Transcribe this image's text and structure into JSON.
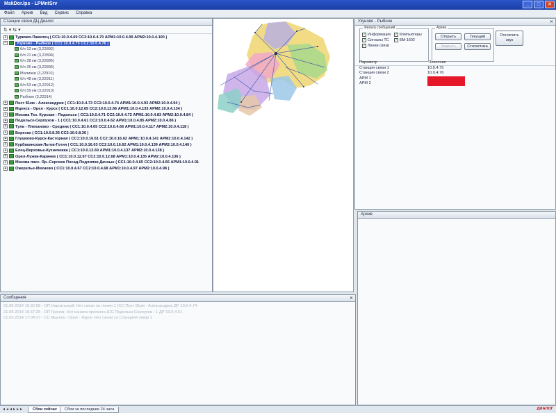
{
  "window": {
    "title": "MskDor.lps - LPMntSrv",
    "controls": [
      "_",
      "□",
      "✕"
    ]
  },
  "menu": [
    "Файл",
    "Архив",
    "Вид",
    "Сервис",
    "Справка"
  ],
  "tree_panel": {
    "title": "Станции связи ДЦ Диалог",
    "toolbar": "⇅ ▾  ⇆ ▾",
    "nodes": [
      {
        "label": "Турково-Павелец ( СС1:10.0.4.69 СС2:10.0.4.70 АРМ1:10.0.4.99 АРМ2:10.0.4.100 )",
        "level": 0,
        "exp": "+"
      },
      {
        "label": "Узуново - Рыбное ( СС1:10.0.4.75 СС2:10.0.4.76 )",
        "level": 0,
        "exp": "−",
        "selected": true
      },
      {
        "label": "б/п 12 км (3,22892)",
        "level": 1
      },
      {
        "label": "б/п 21 км (3,22894)",
        "level": 1
      },
      {
        "label": "б/п 28 км (3,22895)",
        "level": 1
      },
      {
        "label": "б/п 36 км (3,22896)",
        "level": 1
      },
      {
        "label": "Малинки (3,22910)",
        "level": 1
      },
      {
        "label": "б/п 48 км (3,22911)",
        "level": 1
      },
      {
        "label": "б/п 53 км (3,22912)",
        "level": 1
      },
      {
        "label": "б/п 59 км (3,22913)",
        "level": 1
      },
      {
        "label": "Рыбное (3,22914)",
        "level": 1
      },
      {
        "label": "Пост 81км - Александров ( СС1:10.0.4.73 СС2:10.0.4.74 АРМ1:10.0.4.93 АРМ2:10.0.4.94 )",
        "level": 0,
        "exp": "+"
      },
      {
        "label": "Мценск - Орел - Курск ( СС1:10.0.12.65 СС2:10.0.12.66 АРМ1:10.0.4.133 АРМ2:10.0.4.134 )",
        "level": 0,
        "exp": "+"
      },
      {
        "label": "Москва Тех. Курская - Подольск ( СС1:10.0.4.71 СС2:10.0.4.72 АРМ1:10.0.4.83 АРМ2:10.0.4.84 )",
        "level": 0,
        "exp": "+"
      },
      {
        "label": "Подольск-Серпухов - 1 ( СС1:10.0.4.61 СС2:10.0.4.62 АРМ1:10.0.4.85 АРМ2:10.0.4.86 )",
        "level": 0,
        "exp": "+"
      },
      {
        "label": "Тула - Плеханово - Средник ( СС1:10.0.4.65 СС2:10.0.4.66 АРМ1:10.0.4.117 АРМ2:10.0.4.118 )",
        "level": 0,
        "exp": "+"
      },
      {
        "label": "Березки ( СС1:10.0.8.35 СС2:10.0.8.36 )",
        "level": 0,
        "exp": "+"
      },
      {
        "label": "Глушково-Курск-Касторная ( СС1:10.0.16.61 СС2:10.0.16.62 АРМ1:10.0.4.141 АРМ2:10.0.4.142 )",
        "level": 0,
        "exp": "+"
      },
      {
        "label": "Курбакинская-Льгов-Готня ( СС1:10.0.16.63 СС2:10.0.16.62 АРМ1:10.0.4.139 АРМ2:10.0.4.140 )",
        "level": 0,
        "exp": "+"
      },
      {
        "label": "Елец-Верховье-Кузнечевка ( СС1:10.0.12.69 АРМ1:10.0.4.137 АРМ2:10.0.4.138 )",
        "level": 0,
        "exp": "+"
      },
      {
        "label": "Орел-Лужки-Карачев ( СС1:10.0.12.67 СС2:10.0.12.68 АРМ1:10.0.4.135 АРМ2:10.0.4.136 )",
        "level": 0,
        "exp": "+"
      },
      {
        "label": "Москва пасс. Яр.-Сергиев Посад-Подлипки Дачные ( СС1:10.0.4.65 СС2:10.0.4.66 АРМ1:10.0.4.91",
        "level": 0,
        "exp": "+"
      },
      {
        "label": "Ожерелье-Михнево ( СС1:10.0.4.67 СС2:10.0.4.68 АРМ1:10.0.4.97 АРМ2:10.0.4.98 )",
        "level": 0,
        "exp": "+"
      }
    ]
  },
  "station_panel": {
    "title": "Узуново - Рыбное",
    "filter_title": "Фильтр сообщений",
    "filters": [
      {
        "label": "Информация",
        "checked": true
      },
      {
        "label": "Компьютеры",
        "checked": true
      },
      {
        "label": "Сигналы ТС",
        "checked": true
      },
      {
        "label": "БМ-1602",
        "checked": true
      },
      {
        "label": "Линии связи",
        "checked": true
      }
    ],
    "archive_title": "Архив",
    "buttons": {
      "open": "Открыть",
      "current": "Текущий",
      "close": "Закрыть",
      "stats": "Статистика",
      "mute": "Отключить звук"
    },
    "table": {
      "headers": [
        "Параметр",
        "Значение"
      ],
      "rows": [
        {
          "param": "Станция связи 1",
          "value": "10.0.4.75"
        },
        {
          "param": "Станция связи 2",
          "value": "10.0.4.76"
        },
        {
          "param": "АРМ 1",
          "value": "",
          "status_color": "#e5182a"
        },
        {
          "param": "АРМ 2",
          "value": "",
          "status_color": "#e5182a"
        }
      ]
    }
  },
  "messages_panel": {
    "title": "Сообщения",
    "items": [
      "21.08.2014 16:32:58 - ОП Наргальный: Нет связи по линии 1 (СС Пост 81км - Александров ДР 10.0.4.74",
      "21.08.2014 16:37:25 - ОП Гринев: Нет канала пропинга (СС Подольск-Серпухов - 1 ДР 10.0.4.61",
      "01.09.2014 17:04:37 - СС Мценск - Орел - Курск: Нет связи со Станцией связи 1"
    ]
  },
  "archive_panel": {
    "title": "Архив"
  },
  "statusbar": {
    "nav": "◂◂◂▸▸▸",
    "tabs": [
      "Сбои сейчас",
      "Сбои за последние 24 часа"
    ],
    "tray": "ДИАЛОГ"
  },
  "colors": {
    "title_bar": "#1b3fa6",
    "selection": "#2a4fbd",
    "alarm": "#e5182a"
  }
}
